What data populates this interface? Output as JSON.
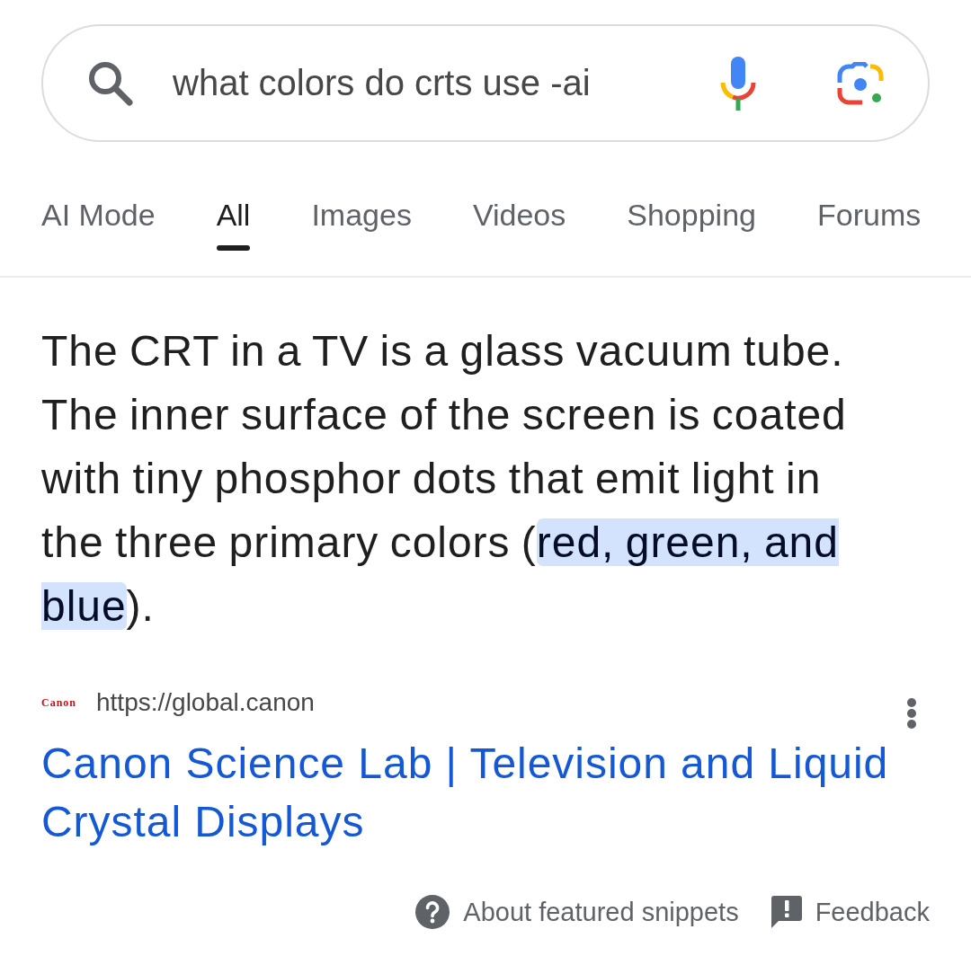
{
  "search": {
    "query": "what colors do crts use -ai"
  },
  "tabs": [
    {
      "label": "AI Mode",
      "selected": false
    },
    {
      "label": "All",
      "selected": true
    },
    {
      "label": "Images",
      "selected": false
    },
    {
      "label": "Videos",
      "selected": false
    },
    {
      "label": "Shopping",
      "selected": false
    },
    {
      "label": "Forums",
      "selected": false
    }
  ],
  "snippet": {
    "parts": [
      {
        "text": "The CRT in a TV is a glass vacuum tube. The inner surface of the screen is coated with tiny phosphor dots that emit light in the three primary colors (",
        "highlighted": false
      },
      {
        "text": "red, green, and blue",
        "highlighted": true
      },
      {
        "text": ").",
        "highlighted": false
      }
    ]
  },
  "result": {
    "site_logo": "Canon",
    "url": "https://global.canon",
    "title": "Canon Science Lab | Television and Liquid Crystal Displays"
  },
  "footer": [
    {
      "kind": "help",
      "label": "About featured snippets"
    },
    {
      "kind": "feedback",
      "label": "Feedback"
    }
  ]
}
